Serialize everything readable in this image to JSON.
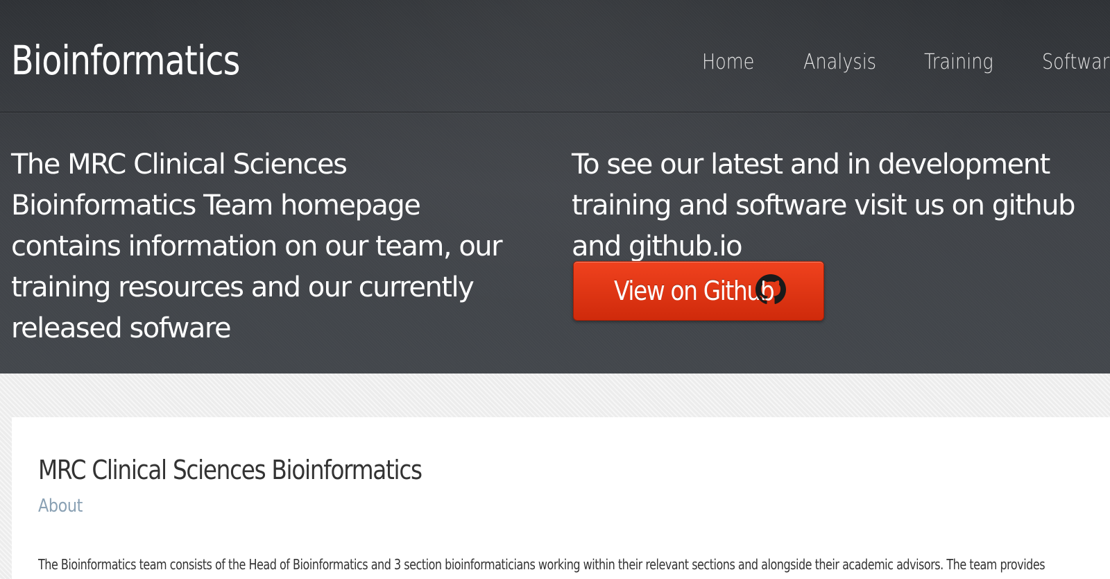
{
  "header": {
    "site_title": "Bioinformatics",
    "nav": [
      {
        "label": "Home"
      },
      {
        "label": "Analysis"
      },
      {
        "label": "Training"
      },
      {
        "label": "Software"
      }
    ]
  },
  "hero": {
    "left_text": "The MRC Clinical Sciences Bioinformatics Team homepage contains information on our team, our training resources and our currently released sofware",
    "right_text": "To see our latest and in development training and software visit us on github and github.io",
    "github_button_label": "View on Github",
    "github_button_icon": "github-icon"
  },
  "main": {
    "title": "MRC Clinical Sciences Bioinformatics",
    "subtitle": "About",
    "body": "The Bioinformatics team consists of the Head of Bioinformatics and 3 section bioinformaticians working within their relevant sections and alongside their academic advisors. The team provides"
  },
  "colors": {
    "header_bg": "#3d4045",
    "button_red": "#e0330f",
    "subtitle_blue": "#8aa1b4",
    "page_bg": "#ececec"
  }
}
